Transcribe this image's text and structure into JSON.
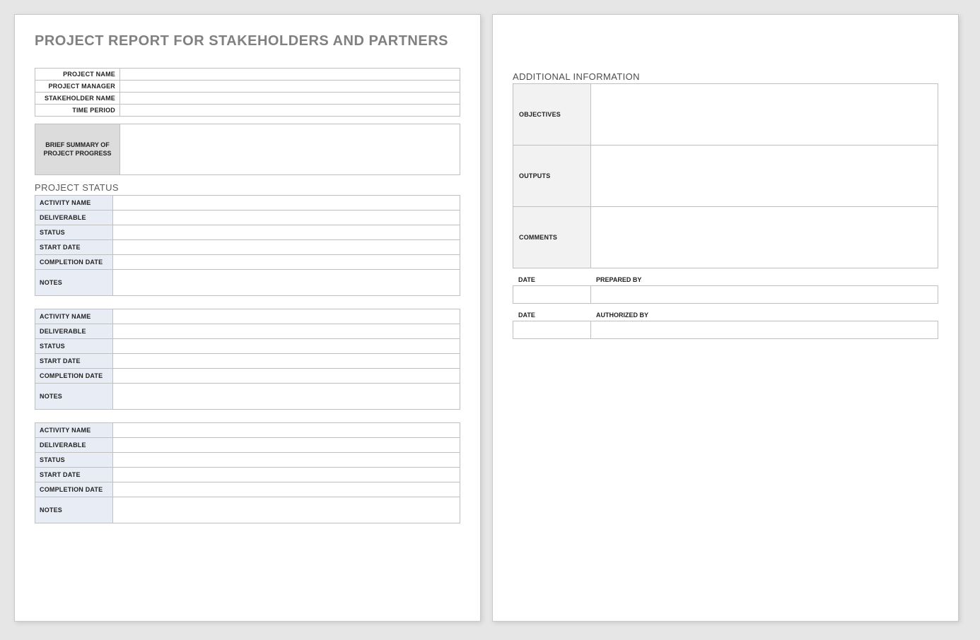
{
  "title": "PROJECT REPORT FOR STAKEHOLDERS AND PARTNERS",
  "header": {
    "project_name_label": "PROJECT NAME",
    "project_name_value": "",
    "project_manager_label": "PROJECT MANAGER",
    "project_manager_value": "",
    "stakeholder_label": "STAKEHOLDER NAME",
    "stakeholder_value": "",
    "time_period_label": "TIME PERIOD",
    "time_period_value": ""
  },
  "summary": {
    "label": "BRIEF SUMMARY OF PROJECT PROGRESS",
    "value": ""
  },
  "status_section_label": "PROJECT STATUS",
  "activity_labels": {
    "activity_name": "ACTIVITY NAME",
    "deliverable": "DELIVERABLE",
    "status": "STATUS",
    "start_date": "START DATE",
    "completion_date": "COMPLETION DATE",
    "notes": "NOTES"
  },
  "activities": [
    {
      "activity_name": "",
      "deliverable": "",
      "status": "",
      "start_date": "",
      "completion_date": "",
      "notes": ""
    },
    {
      "activity_name": "",
      "deliverable": "",
      "status": "",
      "start_date": "",
      "completion_date": "",
      "notes": ""
    },
    {
      "activity_name": "",
      "deliverable": "",
      "status": "",
      "start_date": "",
      "completion_date": "",
      "notes": ""
    }
  ],
  "additional": {
    "section_label": "ADDITIONAL INFORMATION",
    "objectives_label": "OBJECTIVES",
    "objectives_value": "",
    "outputs_label": "OUTPUTS",
    "outputs_value": "",
    "comments_label": "COMMENTS",
    "comments_value": ""
  },
  "signatures": {
    "date_label": "DATE",
    "prepared_by_label": "PREPARED BY",
    "prepared_date_value": "",
    "prepared_by_value": "",
    "authorized_by_label": "AUTHORIZED BY",
    "authorized_date_value": "",
    "authorized_by_value": ""
  }
}
